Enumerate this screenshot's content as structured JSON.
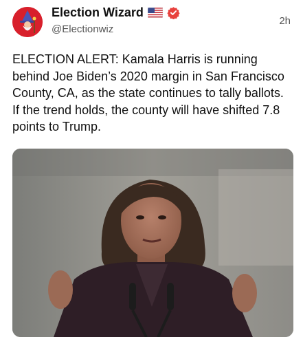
{
  "post": {
    "author_name": "Election Wizard",
    "flag_emoji": "us-flag-icon",
    "verified_badge": "verified-badge-icon",
    "handle": "@Electionwiz",
    "timestamp": "2h",
    "text": "ELECTION ALERT: Kamala Harris is running behind Joe Biden’s 2020 margin in San Francisco County, CA, as the state continues to tally ballots. If the trend holds, the county will have shifted 7.8 points to Trump.",
    "media": {
      "type": "photo"
    }
  },
  "colors": {
    "avatar_bg": "#d8202c",
    "verified": "#e8413d",
    "text": "#111111",
    "secondary_text": "#555555"
  }
}
